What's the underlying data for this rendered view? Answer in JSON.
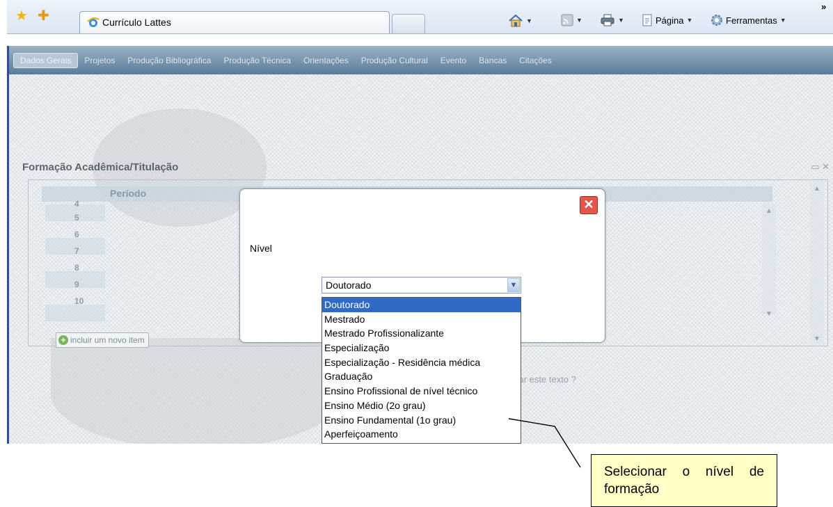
{
  "browser": {
    "tab_title": "Currículo Lattes",
    "page_menu": "Página",
    "tools_menu": "Ferramentas",
    "more": "»"
  },
  "nav": {
    "items": [
      {
        "label": "Dados Gerais",
        "active": true
      },
      {
        "label": "Projetos"
      },
      {
        "label": "Produção Bibliográfica"
      },
      {
        "label": "Produção Técnica"
      },
      {
        "label": "Orientações"
      },
      {
        "label": "Produção Cultural"
      },
      {
        "label": "Evento"
      },
      {
        "label": "Bancas"
      },
      {
        "label": "Citações"
      }
    ]
  },
  "panel": {
    "title": "Formação Acadêmica/Titulação",
    "column_periodo": "Período",
    "rows": [
      "4",
      "5",
      "6",
      "7",
      "8",
      "9",
      "10"
    ],
    "add_item": "incluir um novo item",
    "bg_text_link": "zar este texto ?"
  },
  "modal": {
    "field_label": "Nível",
    "selected_value": "Doutorado",
    "options": [
      "Doutorado",
      "Mestrado",
      "Mestrado Profissionalizante",
      "Especialização",
      "Especialização - Residência médica",
      "Graduação",
      "Ensino Profissional de nível técnico",
      "Ensino Médio (2o grau)",
      "Ensino Fundamental (1o grau)",
      "Aperfeiçoamento"
    ]
  },
  "annotation": {
    "text": "Selecionar o nível de formação"
  },
  "colors": {
    "nav_bar": "#5a7c99",
    "selected_option": "#316ac5",
    "close_button": "#e2574c",
    "callout_bg": "#ffffc6"
  }
}
